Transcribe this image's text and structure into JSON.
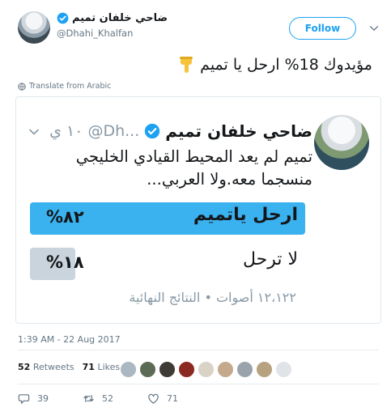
{
  "author": {
    "display_name": "ضاحي خلفان تميم",
    "handle": "@Dhahi_Khalfan",
    "verified_icon": "verified-badge-icon"
  },
  "follow_label": "Follow",
  "tweet": {
    "text": "مؤيدوك 18% ارحل يا تميم",
    "emoji": "backhand-index-pointing-down",
    "translate_label": "Translate from Arabic"
  },
  "embedded": {
    "name": "ضاحي خلفان تميم",
    "handle": "@Dh...",
    "time": "١٠ ي",
    "text": "تميم لم يعد المحيط القيادي الخليجي منسجما معه.ولا العربي...",
    "poll": {
      "options": [
        {
          "label": "ارحل ياتميم",
          "percent_text": "%٨٢",
          "value": 82
        },
        {
          "label": "لا ترحل",
          "percent_text": "%١٨",
          "value": 18
        }
      ],
      "meta": "١٢،١٢٢ أصوات • النتائج النهائية"
    }
  },
  "timestamp": "1:39 AM - 22 Aug 2017",
  "stats": {
    "retweets_count": "52",
    "retweets_label": "Retweets",
    "likes_count": "71",
    "likes_label": "Likes"
  },
  "actions": {
    "reply_count": "39",
    "retweet_count": "52",
    "like_count": "71"
  },
  "colors": {
    "accent": "#1da1f2",
    "poll_winner": "#3bb2f0",
    "poll_other": "#c9d4dc"
  }
}
